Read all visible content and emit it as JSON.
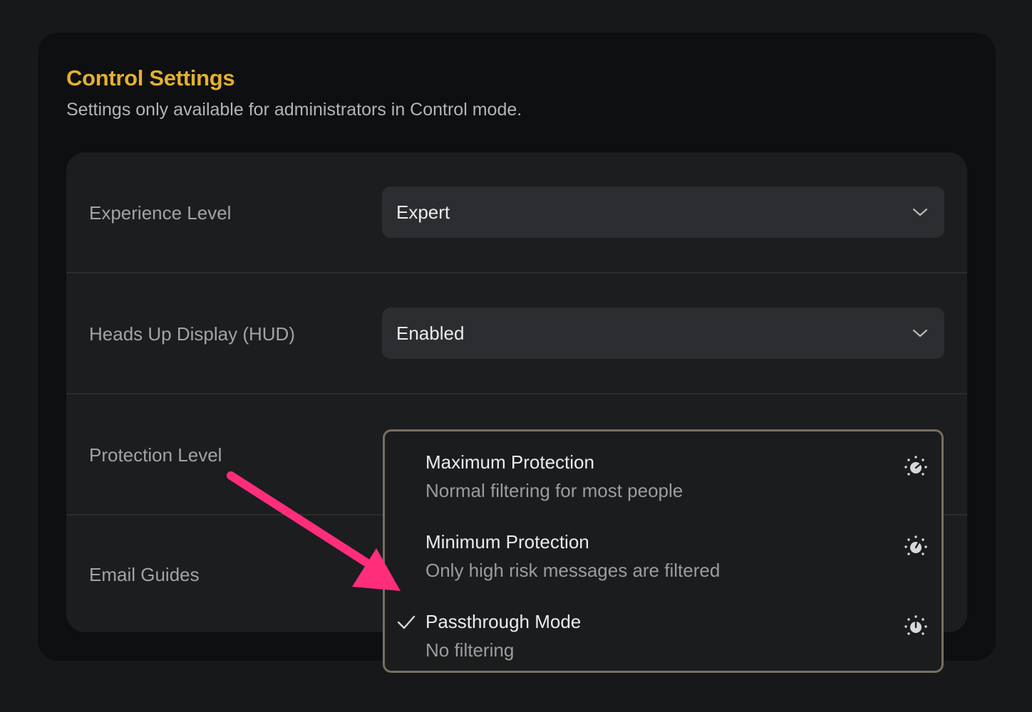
{
  "panel": {
    "title": "Control Settings",
    "subtitle": "Settings only available for administrators in Control mode."
  },
  "settings": {
    "experience_level": {
      "label": "Experience Level",
      "value": "Expert"
    },
    "hud": {
      "label": "Heads Up Display (HUD)",
      "value": "Enabled"
    },
    "protection_level": {
      "label": "Protection Level"
    },
    "email_guides": {
      "label": "Email Guides"
    }
  },
  "protection_dropdown": {
    "options": [
      {
        "title": "Maximum Protection",
        "description": "Normal filtering for most people",
        "icon": "gauge-max-icon",
        "selected": false
      },
      {
        "title": "Minimum Protection",
        "description": "Only high risk messages are filtered",
        "icon": "gauge-min-icon",
        "selected": false
      },
      {
        "title": "Passthrough Mode",
        "description": "No filtering",
        "icon": "gauge-off-icon",
        "selected": true
      }
    ]
  },
  "colors": {
    "accent": "#e4b02e",
    "dropdown_border": "#77705f",
    "annotation_arrow": "#ff2d7a"
  }
}
